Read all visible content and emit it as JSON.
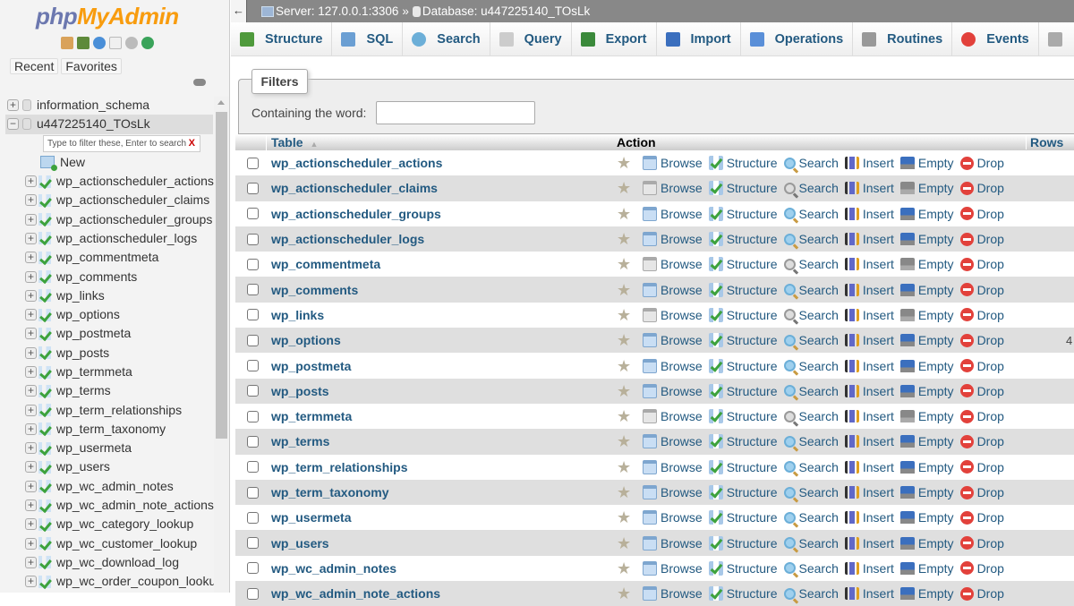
{
  "sidebar": {
    "logo_php": "php",
    "logo_myadmin": "MyAdmin",
    "nav_icons": [
      "home-icon",
      "logout-icon",
      "help-icon",
      "docs-icon",
      "settings-icon",
      "reload-icon"
    ],
    "recent_label": "Recent",
    "favorites_label": "Favorites",
    "databases": [
      {
        "name": "information_schema",
        "expanded": false
      },
      {
        "name": "u447225140_TOsLk",
        "expanded": true
      }
    ],
    "filter_placeholder": "Type to filter these, Enter to search",
    "filter_clear": "X",
    "new_label": "New",
    "tables": [
      "wp_actionscheduler_actions",
      "wp_actionscheduler_claims",
      "wp_actionscheduler_groups",
      "wp_actionscheduler_logs",
      "wp_commentmeta",
      "wp_comments",
      "wp_links",
      "wp_options",
      "wp_postmeta",
      "wp_posts",
      "wp_termmeta",
      "wp_terms",
      "wp_term_relationships",
      "wp_term_taxonomy",
      "wp_usermeta",
      "wp_users",
      "wp_wc_admin_notes",
      "wp_wc_admin_note_actions",
      "wp_wc_category_lookup",
      "wp_wc_customer_lookup",
      "wp_wc_download_log",
      "wp_wc_order_coupon_lookup"
    ]
  },
  "breadcrumb": {
    "back": "←",
    "server": "Server: 127.0.0.1:3306",
    "separator": "»",
    "database": "Database: u447225140_TOsLk"
  },
  "tabs": [
    {
      "label": "Structure",
      "icon": "structure-icon"
    },
    {
      "label": "SQL",
      "icon": "sql-icon"
    },
    {
      "label": "Search",
      "icon": "search-icon"
    },
    {
      "label": "Query",
      "icon": "query-icon"
    },
    {
      "label": "Export",
      "icon": "export-icon"
    },
    {
      "label": "Import",
      "icon": "import-icon"
    },
    {
      "label": "Operations",
      "icon": "operations-icon"
    },
    {
      "label": "Routines",
      "icon": "routines-icon"
    },
    {
      "label": "Events",
      "icon": "events-icon"
    },
    {
      "label": "",
      "icon": "triggers-icon"
    }
  ],
  "filters": {
    "legend": "Filters",
    "label": "Containing the word:",
    "value": ""
  },
  "table": {
    "headers": {
      "table": "Table",
      "sort_indicator": "▲",
      "action": "Action",
      "rows": "Rows"
    },
    "actions": [
      "Browse",
      "Structure",
      "Search",
      "Insert",
      "Empty",
      "Drop"
    ],
    "rows": [
      {
        "name": "wp_actionscheduler_actions",
        "empty": false,
        "rows": ""
      },
      {
        "name": "wp_actionscheduler_claims",
        "empty": true,
        "rows": ""
      },
      {
        "name": "wp_actionscheduler_groups",
        "empty": false,
        "rows": ""
      },
      {
        "name": "wp_actionscheduler_logs",
        "empty": false,
        "rows": ""
      },
      {
        "name": "wp_commentmeta",
        "empty": true,
        "rows": ""
      },
      {
        "name": "wp_comments",
        "empty": false,
        "rows": ""
      },
      {
        "name": "wp_links",
        "empty": true,
        "rows": ""
      },
      {
        "name": "wp_options",
        "empty": false,
        "rows": "4"
      },
      {
        "name": "wp_postmeta",
        "empty": false,
        "rows": ""
      },
      {
        "name": "wp_posts",
        "empty": false,
        "rows": ""
      },
      {
        "name": "wp_termmeta",
        "empty": true,
        "rows": ""
      },
      {
        "name": "wp_terms",
        "empty": false,
        "rows": ""
      },
      {
        "name": "wp_term_relationships",
        "empty": false,
        "rows": ""
      },
      {
        "name": "wp_term_taxonomy",
        "empty": false,
        "rows": ""
      },
      {
        "name": "wp_usermeta",
        "empty": false,
        "rows": ""
      },
      {
        "name": "wp_users",
        "empty": false,
        "rows": ""
      },
      {
        "name": "wp_wc_admin_notes",
        "empty": false,
        "rows": ""
      },
      {
        "name": "wp_wc_admin_note_actions",
        "empty": false,
        "rows": ""
      }
    ]
  },
  "colors": {
    "link": "#235a81",
    "logo_php": "#6c78af",
    "logo_myadmin": "#f89c0e",
    "drop": "#e2413b",
    "server_bar": "#888888"
  }
}
